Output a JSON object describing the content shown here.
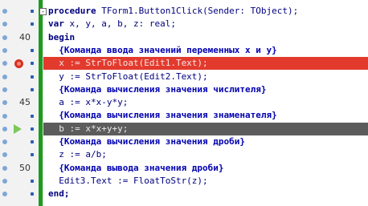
{
  "editor": {
    "lines": [
      {
        "num": "",
        "collapse": "-",
        "parts": [
          {
            "t": "procedure ",
            "k": "kw"
          },
          {
            "t": "TForm1.Button1Click(Sender: TObject);",
            "k": ""
          }
        ]
      },
      {
        "num": "",
        "parts": [
          {
            "t": "var ",
            "k": "kw"
          },
          {
            "t": "x, y, a, b, z: real;",
            "k": ""
          }
        ]
      },
      {
        "num": "40",
        "parts": [
          {
            "t": "begin",
            "k": "kw"
          }
        ]
      },
      {
        "num": "",
        "parts": [
          {
            "t": "  {Команда ввода значений переменных x и y}",
            "k": "cm"
          }
        ]
      },
      {
        "num": "",
        "breakpoint": true,
        "highlight": "red",
        "parts": [
          {
            "t": "  x := StrToFloat(Edit1.Text);",
            "k": ""
          }
        ]
      },
      {
        "num": "",
        "parts": [
          {
            "t": "  y := StrToFloat(Edit2.Text);",
            "k": ""
          }
        ]
      },
      {
        "num": "",
        "parts": [
          {
            "t": "  {Команда вычисления значения числителя}",
            "k": "cm"
          }
        ]
      },
      {
        "num": "45",
        "parts": [
          {
            "t": "  a := x*x-y*y;",
            "k": ""
          }
        ]
      },
      {
        "num": "",
        "parts": [
          {
            "t": "  {Команда вычисления значения знаменателя}",
            "k": "cm"
          }
        ]
      },
      {
        "num": "",
        "exec": true,
        "highlight": "dark",
        "parts": [
          {
            "t": "  b := x*x+y+y;",
            "k": ""
          }
        ]
      },
      {
        "num": "",
        "parts": [
          {
            "t": "  {Команда вычисления значения дроби}",
            "k": "cm"
          }
        ]
      },
      {
        "num": "",
        "parts": [
          {
            "t": "  z := a/b;",
            "k": ""
          }
        ]
      },
      {
        "num": "50",
        "parts": [
          {
            "t": "  {Команда вывода значения дроби}",
            "k": "cm"
          }
        ]
      },
      {
        "num": "",
        "parts": [
          {
            "t": "  Edit3.Text := FloatToStr(z);",
            "k": ""
          }
        ]
      },
      {
        "num": "",
        "parts": [
          {
            "t": "end;",
            "k": "kw"
          }
        ]
      }
    ]
  },
  "colors": {
    "gutter_bar": "#1f9a1f",
    "breakpoint_line": "#e33a2e",
    "execution_line": "#5c5c5c",
    "code_text": "#000080"
  }
}
